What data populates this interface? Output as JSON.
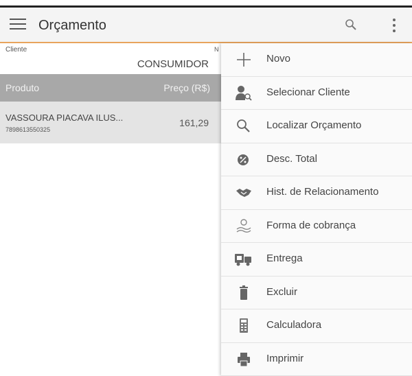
{
  "app": {
    "title": "Orçamento",
    "accent_color": "#e8a45c"
  },
  "appbar": {
    "menu_icon": "hamburger-icon",
    "search_icon": "search-icon",
    "overflow_icon": "more-vert-icon"
  },
  "client": {
    "label": "Cliente",
    "value": "CONSUMIDOR",
    "extra_label": "N"
  },
  "table": {
    "columns": [
      "Produto",
      "Preço (R$)"
    ],
    "rows": [
      {
        "name": "VASSOURA PIACAVA ILUS...",
        "code": "7898613550325",
        "price": "161,29"
      }
    ]
  },
  "menu": {
    "items": [
      {
        "label": "Novo",
        "icon": "plus-icon"
      },
      {
        "label": "Selecionar Cliente",
        "icon": "user-search-icon"
      },
      {
        "label": "Localizar Orçamento",
        "icon": "search-icon"
      },
      {
        "label": "Desc. Total",
        "icon": "discount-icon"
      },
      {
        "label": "Hist. de Relacionamento",
        "icon": "handshake-icon"
      },
      {
        "label": "Forma de cobrança",
        "icon": "payment-icon"
      },
      {
        "label": "Entrega",
        "icon": "delivery-icon"
      },
      {
        "label": "Excluir",
        "icon": "trash-icon"
      },
      {
        "label": "Calculadora",
        "icon": "calculator-icon"
      },
      {
        "label": "Imprimir",
        "icon": "printer-icon"
      }
    ]
  }
}
